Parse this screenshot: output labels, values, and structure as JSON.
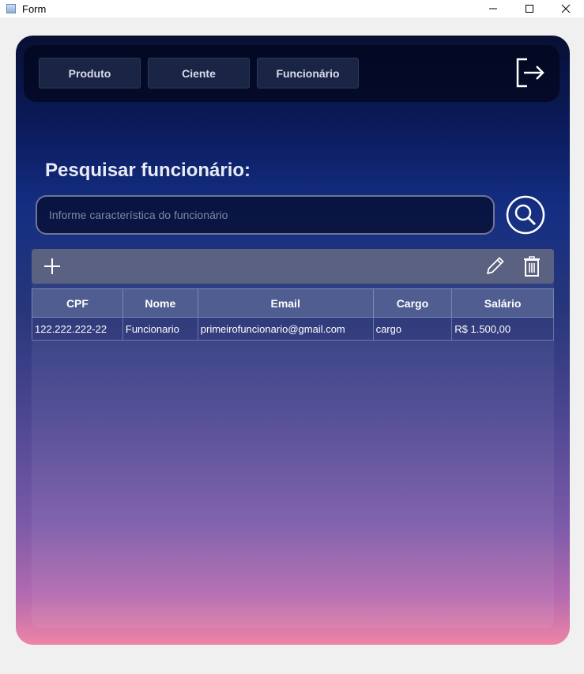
{
  "window": {
    "title": "Form",
    "controls": {
      "minimize": "—",
      "maximize": "☐",
      "close": "✕"
    }
  },
  "nav": {
    "items": [
      {
        "label": "Produto"
      },
      {
        "label": "Ciente"
      },
      {
        "label": "Funcionário"
      }
    ],
    "logout_icon": "logout-icon"
  },
  "search": {
    "title": "Pesquisar funcionário:",
    "placeholder": "Informe característica do funcionário",
    "value": "",
    "icon": "search-icon"
  },
  "toolbar": {
    "add_icon": "plus-icon",
    "edit_icon": "pencil-icon",
    "delete_icon": "trash-icon"
  },
  "table": {
    "columns": [
      "CPF",
      "Nome",
      "Email",
      "Cargo",
      "Salário"
    ],
    "rows": [
      [
        "122.222.222-22",
        "Funcionario",
        "primeirofuncionario@gmail.com",
        "cargo",
        "R$ 1.500,00"
      ]
    ]
  },
  "colors": {
    "gradient_top": "#071032",
    "gradient_bottom": "#ee84a6",
    "toolbar": "#5b6180",
    "table_header": "#4f5d90"
  }
}
